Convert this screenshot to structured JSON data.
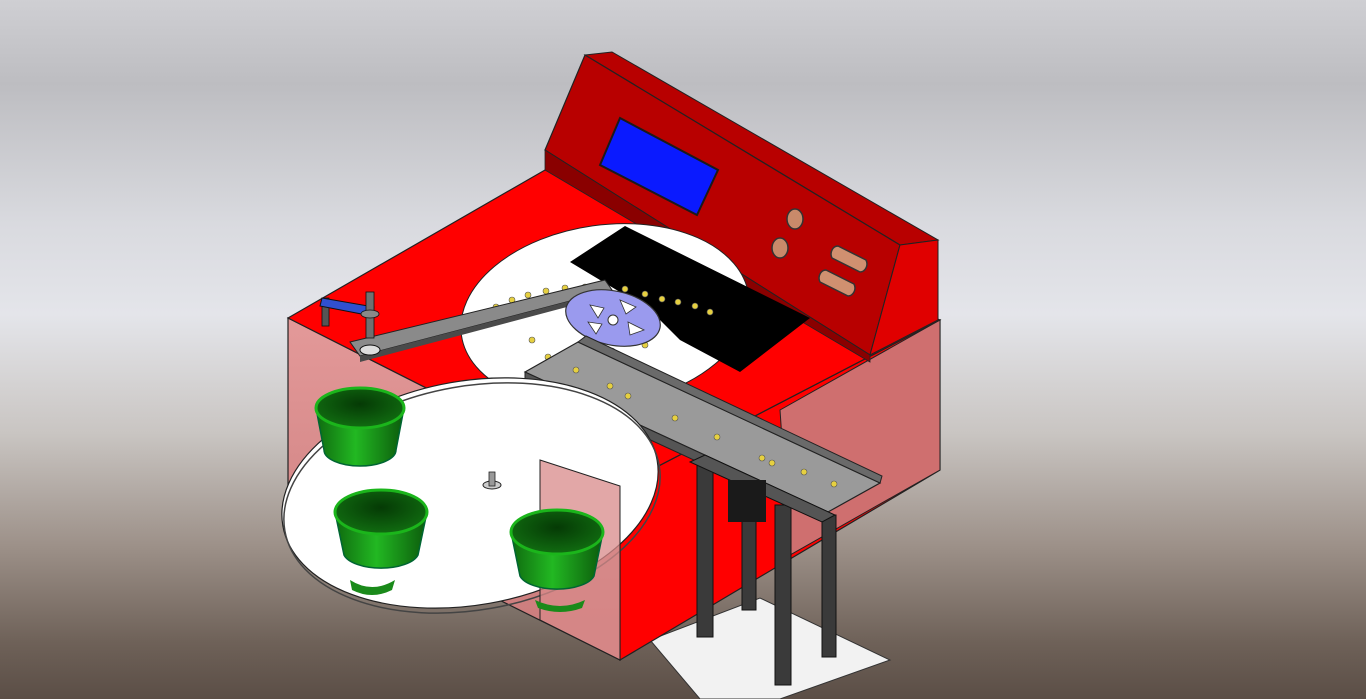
{
  "scene": {
    "colors": {
      "housing": "#ff0000",
      "housing_dark": "#c80000",
      "housing_shadow": "#960000",
      "transparent_panel": "#d88a8a",
      "turntable": "#ffffff",
      "cups": "#1a9a1a",
      "cups_dark": "#0a5a0a",
      "screen": "#0a1aff",
      "rails": "#9a9a9a",
      "rails_dark": "#5a5a5a",
      "sprocket": "#9a9aee",
      "rivets": "#e6d040",
      "arm": "#3050d0",
      "black_plate": "#000000",
      "legs": "#3a3a3a"
    },
    "icons": [
      "screen-icon",
      "knob-icon",
      "slot-button-icon",
      "sprocket-icon",
      "cup-icon"
    ]
  }
}
